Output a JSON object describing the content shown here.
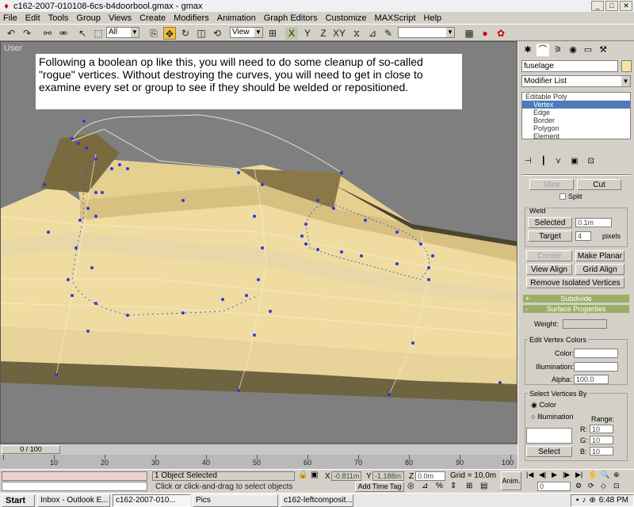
{
  "window": {
    "title": "c162-2007-010108-6cs-b4doorbool.gmax - gmax",
    "app_icon": "gmax-icon"
  },
  "menu": [
    "File",
    "Edit",
    "Tools",
    "Group",
    "Views",
    "Create",
    "Modifiers",
    "Animation",
    "Graph Editors",
    "Customize",
    "MAXScript",
    "Help"
  ],
  "toolbar": {
    "selection_filter": "All",
    "ref_coord": "View"
  },
  "viewport": {
    "label": "User",
    "callout": "Following a boolean op like this, you will need to do some cleanup of so-called \"rogue\" vertices.  Without destroying the curves, you will need to get in close to examine every set or group to see if they should be welded or repositioned."
  },
  "command_panel": {
    "object_name": "fuselage",
    "modifier_list": "Modifier List",
    "stack": {
      "top": "Editable Poly",
      "items": [
        "Vertex",
        "Edge",
        "Border",
        "Polygon",
        "Element"
      ],
      "selected": "Vertex"
    },
    "slice_label": "Slice",
    "cut_label": "Cut",
    "split_label": "Split",
    "weld_group": "Weld",
    "weld_selected": "Selected",
    "weld_selected_value": "0.1m",
    "weld_target": "Target",
    "weld_target_value": "4",
    "pixels_label": "pixels",
    "create_shape": "Create Shape",
    "make_planar": "Make Planar",
    "view_align": "View Align",
    "grid_align": "Grid Align",
    "remove_isolated": "Remove Isolated Vertices",
    "subdivide_plus": "+",
    "subdivide": "Subdivide",
    "surface_minus": "-",
    "surface_properties": "Surface Properties",
    "weight_label": "Weight:",
    "edit_vertex_colors": "Edit Vertex Colors",
    "color_label": "Color:",
    "illumination_label": "Illumination:",
    "alpha_label": "Alpha:",
    "alpha_value": "100.0",
    "select_vertices_by": "Select Vertices By",
    "radio_color": "Color",
    "radio_illumination": "Illumination",
    "range_label": "Range:",
    "r_label": "R:",
    "g_label": "G:",
    "b_label": "B:",
    "r_value": "10",
    "g_value": "10",
    "b_value": "10",
    "select_button": "Select"
  },
  "timeline": {
    "frame_readout": "0 / 100",
    "ticks": [
      "10",
      "20",
      "30",
      "40",
      "50",
      "60",
      "70",
      "80",
      "90",
      "100"
    ]
  },
  "status": {
    "selection": "1 Object Selected",
    "prompt": "Click or click-and-drag to select objects",
    "x_label": "X",
    "x_value": "-0.811m",
    "y_label": "Y",
    "y_value": "-1.188m",
    "z_label": "Z",
    "z_value": "0.0m",
    "grid": "Grid = 10.0m",
    "add_time_tag": "Add Time Tag",
    "anim_label": "Anim.",
    "frame_value": "0"
  },
  "taskbar": {
    "start": "Start",
    "tasks": [
      "Inbox - Outlook E...",
      "c162-2007-010...",
      "Pics",
      "c162-leftcomposit..."
    ],
    "clock": "6:48 PM"
  },
  "colors": {
    "mesh_face": "#f0dca0",
    "mesh_shadow": "#6e6440",
    "vertex": "#2a3ce0",
    "viewport_bg": "#7f7f7f",
    "rollout_header": "#9aaf66"
  }
}
